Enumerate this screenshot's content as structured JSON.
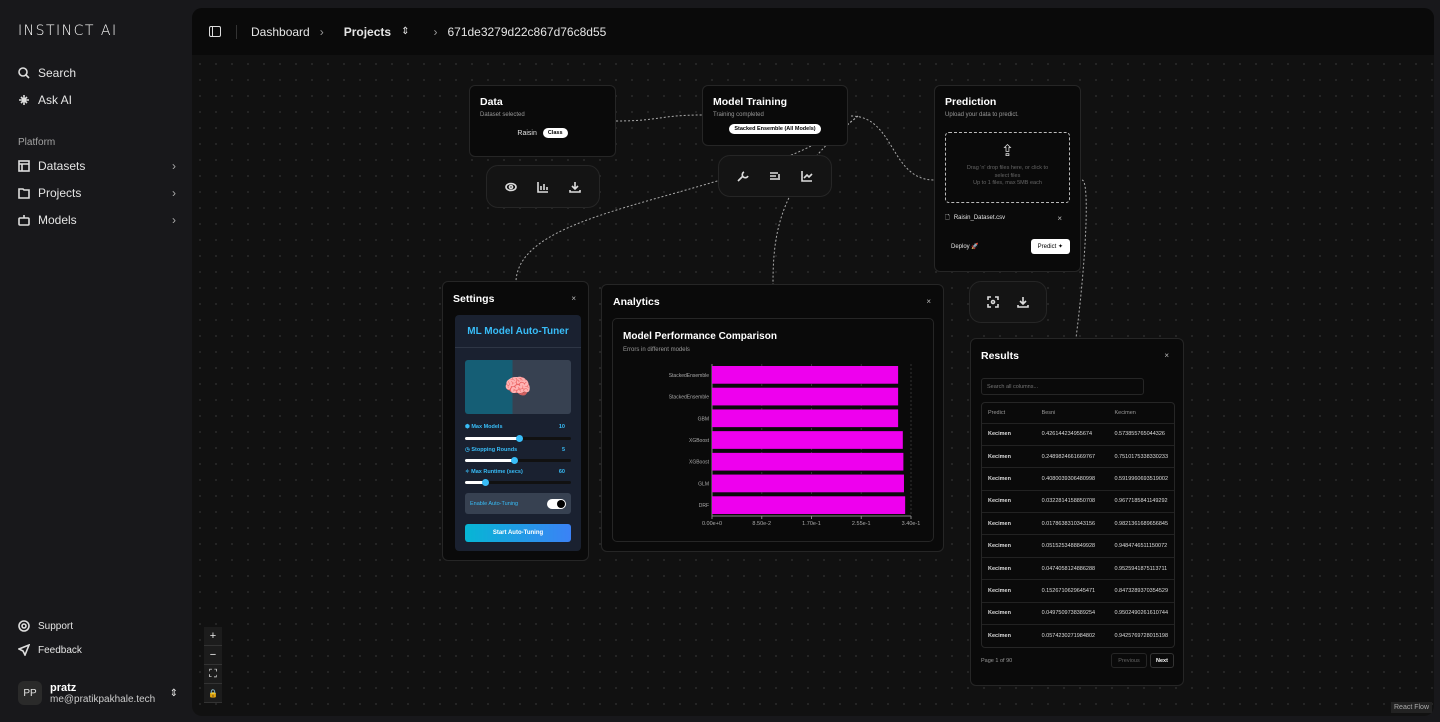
{
  "app": {
    "logo": "INSTINCT AI"
  },
  "sidebar": {
    "search": "Search",
    "ask_ai": "Ask AI",
    "section": "Platform",
    "items": [
      {
        "label": "Datasets",
        "icon": "table-icon"
      },
      {
        "label": "Projects",
        "icon": "folder-icon"
      },
      {
        "label": "Models",
        "icon": "bot-icon"
      }
    ],
    "support": "Support",
    "feedback": "Feedback",
    "user": {
      "initials": "PP",
      "name": "pratz",
      "email": "me@pratikpakhale.tech"
    }
  },
  "breadcrumb": {
    "dashboard": "Dashboard",
    "projects": "Projects",
    "project_id": "671de3279d22c867d76c8d55"
  },
  "data_node": {
    "title": "Data",
    "subtitle": "Dataset selected",
    "dataset": "Raisin",
    "badge": "Class"
  },
  "training_node": {
    "title": "Model Training",
    "subtitle": "Training completed",
    "badge": "Stacked Ensemble (All Models)"
  },
  "prediction_node": {
    "title": "Prediction",
    "subtitle": "Upload your data to predict.",
    "drop_text": "Drag 'n' drop files here, or click to select files",
    "drop_limit": "Up to 1 files, max 5MB each",
    "file": "Raisin_Dataset.csv",
    "deploy": "Deploy",
    "predict": "Predict"
  },
  "settings": {
    "title": "Settings",
    "heading": "ML Model Auto-Tuner",
    "max_models_label": "Max Models",
    "max_models": "10",
    "max_models_level": 0.5,
    "stopping_label": "Stopping Rounds",
    "stopping": "5",
    "stopping_level": 0.45,
    "runtime_label": "Max Runtime (secs)",
    "runtime": "60",
    "runtime_level": 0.18,
    "auto_tuning_label": "Enable Auto-Tuning",
    "auto_tuning": true,
    "start": "Start Auto-Tuning",
    "accent": "#38bdf8"
  },
  "analytics": {
    "title": "Analytics"
  },
  "chart_data": {
    "type": "bar",
    "orientation": "horizontal",
    "title": "Model Performance Comparison",
    "subtitle": "Errors in different models",
    "categories": [
      "StackedEnsemble",
      "StackedEnsemble",
      "GBM",
      "XGBoost",
      "XGBoost",
      "GLM",
      "DRF"
    ],
    "values": [
      0.318,
      0.318,
      0.318,
      0.326,
      0.327,
      0.328,
      0.33
    ],
    "xlim": [
      0,
      0.34
    ],
    "xticks": [
      "0.00e+0",
      "8.50e-2",
      "1.70e-1",
      "2.55e-1",
      "3.40e-1"
    ],
    "color": "#ee00ee",
    "grid": true
  },
  "results": {
    "title": "Results",
    "search_placeholder": "Search all columns...",
    "columns": [
      "Predict",
      "Besni",
      "Kecimen"
    ],
    "rows": [
      [
        "Kecimen",
        "0.426144234955674",
        "0.573855765044326"
      ],
      [
        "Kecimen",
        "0.2489824661669767",
        "0.7510175338330233"
      ],
      [
        "Kecimen",
        "0.4080039306480998",
        "0.5919960693519002"
      ],
      [
        "Kecimen",
        "0.0322814158850708",
        "0.9677185841149292"
      ],
      [
        "Kecimen",
        "0.0178638310343156",
        "0.9821361689656845"
      ],
      [
        "Kecimen",
        "0.0515253488849928",
        "0.9484746511150072"
      ],
      [
        "Kecimen",
        "0.0474058124886288",
        "0.9525941875113711"
      ],
      [
        "Kecimen",
        "0.1526710629645471",
        "0.8473289370354529"
      ],
      [
        "Kecimen",
        "0.0497509738389254",
        "0.9502490261610744"
      ],
      [
        "Kecimen",
        "0.0574230271984802",
        "0.9425769728015198"
      ]
    ],
    "page_info": "Page 1 of 90",
    "previous": "Previous",
    "next": "Next"
  },
  "attribution": "React Flow"
}
